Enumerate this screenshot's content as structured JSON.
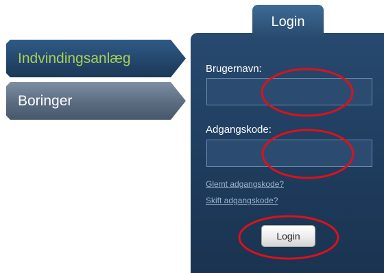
{
  "nav": {
    "items": [
      {
        "label": "Indvindingsanlæg",
        "active": true
      },
      {
        "label": "Boringer",
        "active": false
      }
    ]
  },
  "login": {
    "tab_label": "Login",
    "username_label": "Brugernavn:",
    "username_value": "",
    "password_label": "Adgangskode:",
    "password_value": "",
    "forgot_link": "Glemt adgangskode?",
    "change_link": "Skift adgangskode?",
    "submit_label": "Login"
  },
  "colors": {
    "panel": "#1f3d5f",
    "active_nav_text": "#a8cf58",
    "annotation": "#e0101a"
  }
}
